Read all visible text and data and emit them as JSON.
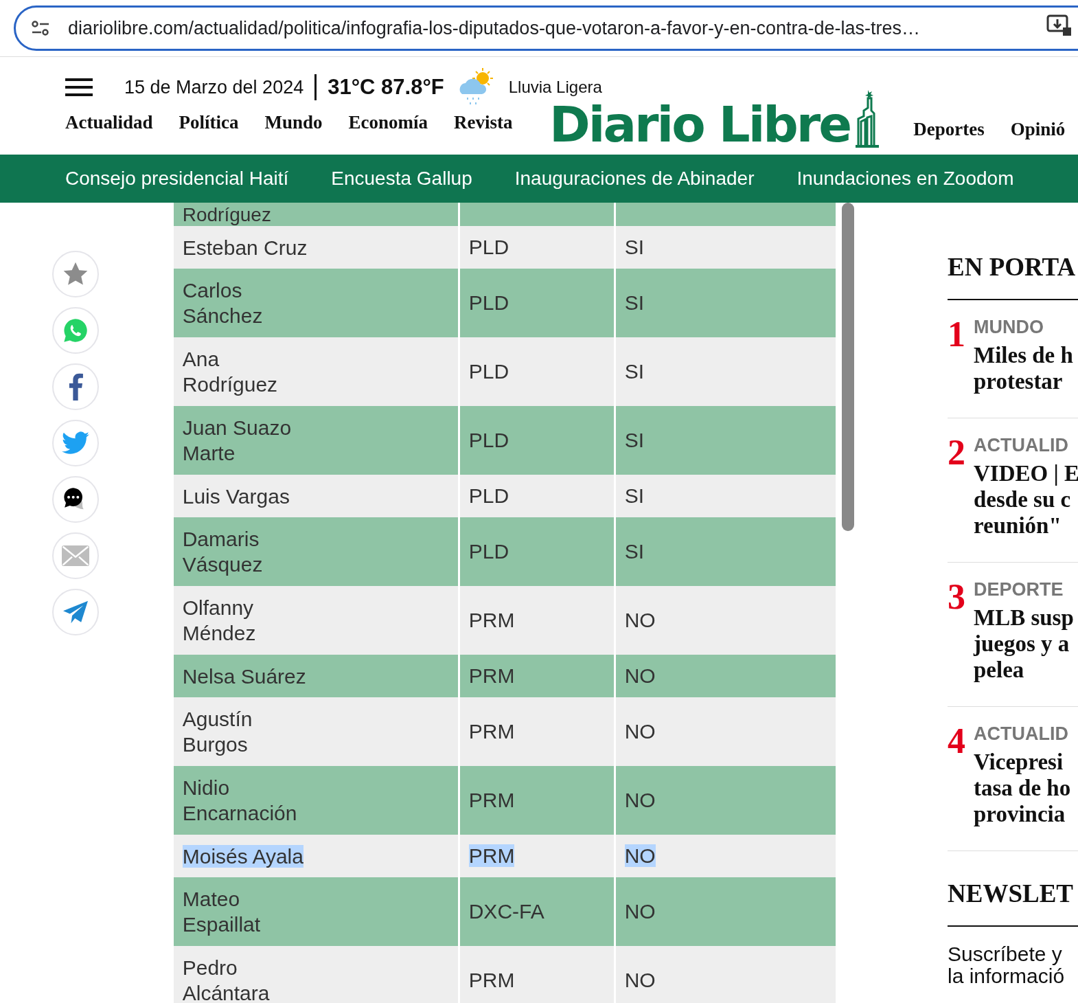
{
  "address_bar": {
    "url": "diariolibre.com/actualidad/politica/infografia-los-diputados-que-votaron-a-favor-y-en-contra-de-las-tres…"
  },
  "header": {
    "date": "15 de Marzo del 2024",
    "temperature": "31°C 87.8°F",
    "weather": "Lluvia Ligera",
    "logo": "Diario Libre",
    "nav_left": [
      "Actualidad",
      "Política",
      "Mundo",
      "Economía",
      "Revista"
    ],
    "nav_right": [
      "Deportes",
      "Opinió"
    ]
  },
  "trending": [
    "Consejo presidencial Haití",
    "Encuesta Gallup",
    "Inauguraciones de Abinader",
    "Inundaciones en Zoodom"
  ],
  "share_buttons": [
    {
      "kind": "star"
    },
    {
      "kind": "whatsapp"
    },
    {
      "kind": "facebook"
    },
    {
      "kind": "twitter"
    },
    {
      "kind": "comment"
    },
    {
      "kind": "email"
    },
    {
      "kind": "telegram"
    }
  ],
  "table": {
    "rows": [
      {
        "name": "Rodríguez",
        "party": "",
        "vote": "",
        "selected": false,
        "cut": true
      },
      {
        "name": "Esteban Cruz",
        "party": "PLD",
        "vote": "SI",
        "selected": false
      },
      {
        "name": "Carlos Sánchez",
        "party": "PLD",
        "vote": "SI",
        "selected": false
      },
      {
        "name": "Ana Rodríguez",
        "party": "PLD",
        "vote": "SI",
        "selected": false
      },
      {
        "name": "Juan Suazo Marte",
        "party": "PLD",
        "vote": "SI",
        "selected": false
      },
      {
        "name": "Luis Vargas",
        "party": "PLD",
        "vote": "SI",
        "selected": false
      },
      {
        "name": "Damaris Vásquez",
        "party": "PLD",
        "vote": "SI",
        "selected": false
      },
      {
        "name": "Olfanny Méndez",
        "party": "PRM",
        "vote": "NO",
        "selected": false
      },
      {
        "name": "Nelsa Suárez",
        "party": "PRM",
        "vote": "NO",
        "selected": false
      },
      {
        "name": "Agustín Burgos",
        "party": "PRM",
        "vote": "NO",
        "selected": false
      },
      {
        "name": "Nidio Encarnación",
        "party": "PRM",
        "vote": "NO",
        "selected": false
      },
      {
        "name": "Moisés Ayala",
        "party": "PRM",
        "vote": "NO",
        "selected": true
      },
      {
        "name": "Mateo Espaillat",
        "party": "DXC-FA",
        "vote": "NO",
        "selected": false
      },
      {
        "name": "Pedro Alcántara",
        "party": "PRM",
        "vote": "NO",
        "selected": false
      }
    ]
  },
  "sidebar": {
    "title": "EN PORTA",
    "stories": [
      {
        "rank": "1",
        "section": "MUNDO",
        "headline": [
          "Miles de h",
          "protestar"
        ]
      },
      {
        "rank": "2",
        "section": "ACTUALID",
        "headline": [
          "VIDEO | E",
          "desde su c",
          "reunión\""
        ]
      },
      {
        "rank": "3",
        "section": "DEPORTE",
        "headline": [
          "MLB susp",
          "juegos y a",
          "pelea"
        ]
      },
      {
        "rank": "4",
        "section": "ACTUALID",
        "headline": [
          "Vicepresi",
          "tasa de ho",
          "provincia"
        ]
      }
    ],
    "newsletter_title": "NEWSLET",
    "newsletter_text": [
      "Suscríbete y",
      "la informació"
    ]
  }
}
